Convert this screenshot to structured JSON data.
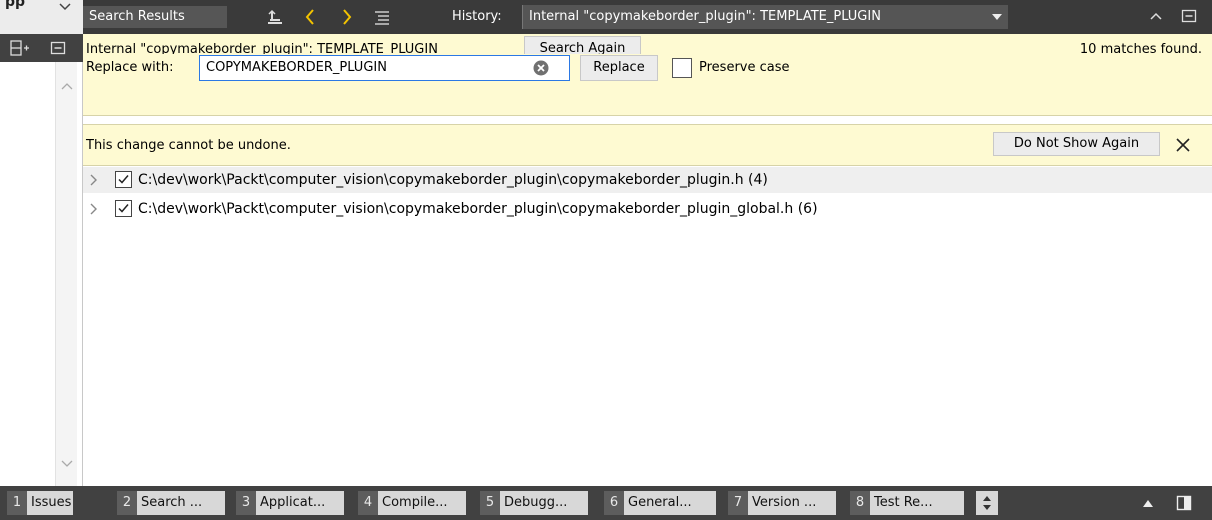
{
  "left": {
    "pp_label": "pp"
  },
  "titlebar": {
    "panel_title": "Search Results",
    "history_label": "History:",
    "history_value": "Internal \"copymakeborder_plugin\": TEMPLATE_PLUGIN"
  },
  "search": {
    "term": "Internal \"copymakeborder_plugin\":  TEMPLATE_PLUGIN",
    "search_again_label": "Search Again",
    "matches": "10 matches found.",
    "replace_label": "Replace with:",
    "replace_value": "COPYMAKEBORDER_PLUGIN",
    "replace_button_label": "Replace",
    "preserve_case_label": "Preserve case",
    "preserve_case_checked": false
  },
  "warning": {
    "text": "This change cannot be undone.",
    "dont_show_label": "Do Not Show Again"
  },
  "results": [
    {
      "path": "C:\\dev\\work\\Packt\\computer_vision\\copymakeborder_plugin\\copymakeborder_plugin.h (4)",
      "checked": true,
      "selected": true
    },
    {
      "path": "C:\\dev\\work\\Packt\\computer_vision\\copymakeborder_plugin\\copymakeborder_plugin_global.h (6)",
      "checked": true,
      "selected": false
    }
  ],
  "output_tabs": [
    {
      "num": "1",
      "label": "Issues"
    },
    {
      "num": "2",
      "label": "Search ..."
    },
    {
      "num": "3",
      "label": "Applicat..."
    },
    {
      "num": "4",
      "label": "Compile..."
    },
    {
      "num": "5",
      "label": "Debugg..."
    },
    {
      "num": "6",
      "label": "General..."
    },
    {
      "num": "7",
      "label": "Version ..."
    },
    {
      "num": "8",
      "label": "Test Re..."
    }
  ],
  "colors": {
    "panel_dark": "#3a3a3a",
    "info_yellow": "#fefad2",
    "input_border": "#2b78e4",
    "tab_number_bg": "#5d5d5d"
  },
  "icons": {
    "expand_all": "expand-all-icon",
    "prev": "chevron-left-icon",
    "next": "chevron-right-icon",
    "list": "list-icon",
    "collapse": "chevron-up-icon",
    "close_panel": "minimize-panel-icon",
    "clear": "clear-icon",
    "close": "close-icon"
  }
}
